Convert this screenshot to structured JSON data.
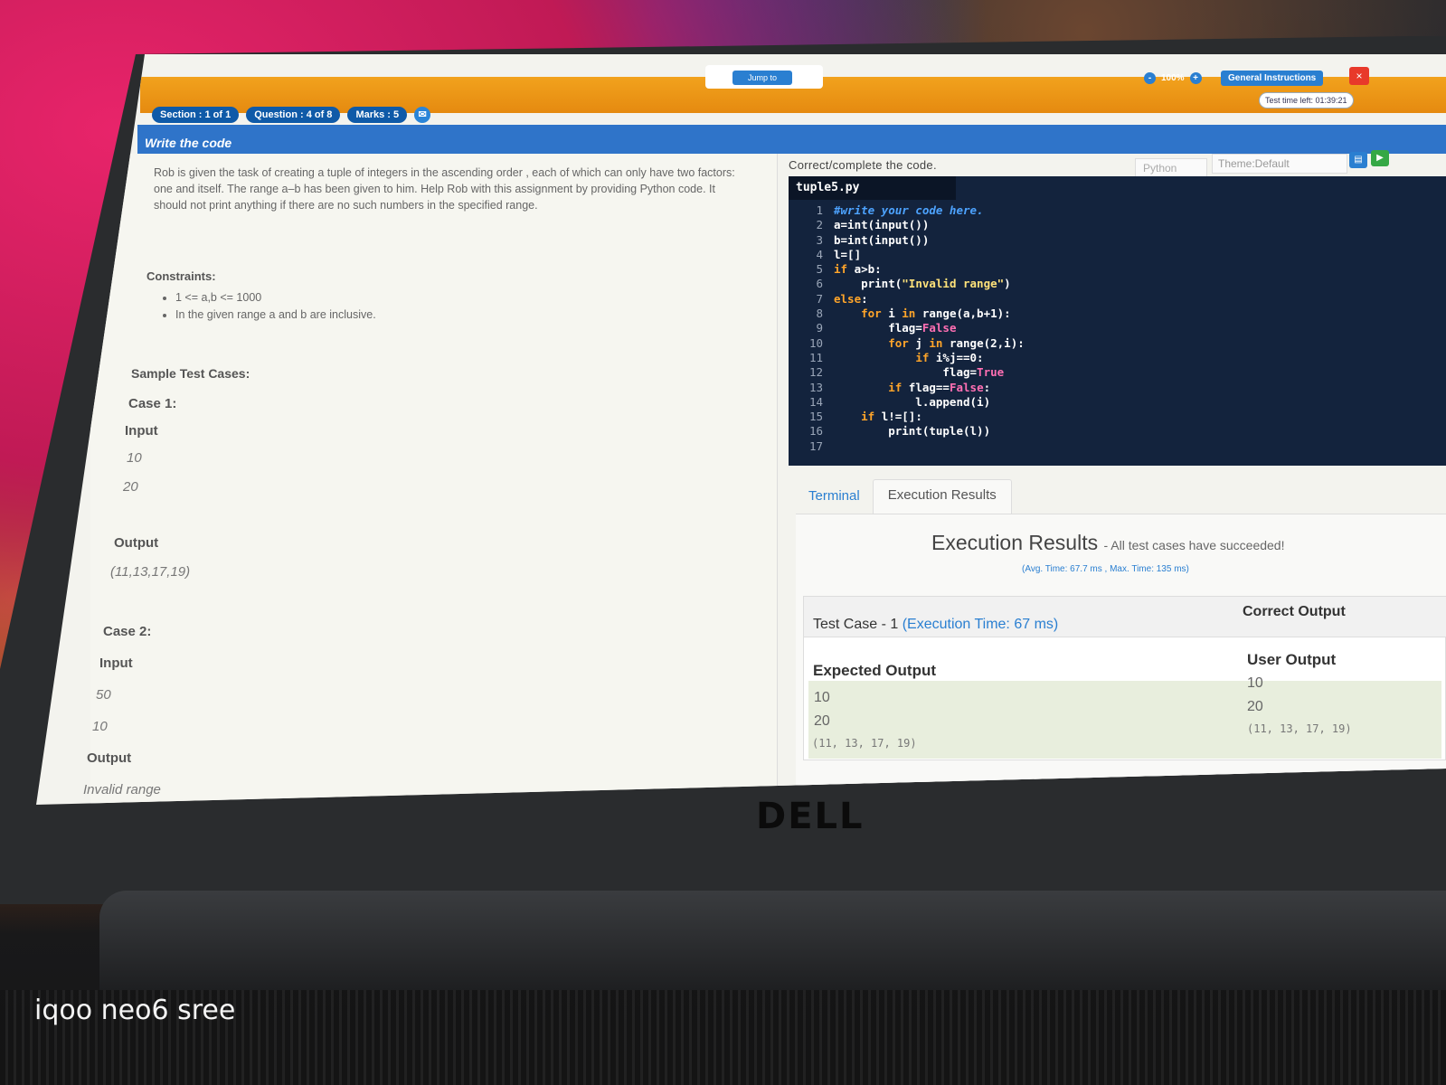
{
  "watermark": "iqoo neo6 sree",
  "brand": "DELL",
  "header": {
    "jump_label": "Jump to",
    "zoom": "100%",
    "zoom_minus": "-",
    "zoom_plus": "+",
    "instructions_label": "General Instructions",
    "close_label": "×",
    "timer": "Test time left: 01:39:21",
    "section": "Section : 1 of 1",
    "question": "Question : 4 of 8",
    "marks": "Marks : 5",
    "title": "Write the code"
  },
  "problem": {
    "text": "Rob is given the task of creating a tuple of integers in the ascending order , each of which can only have two factors: one and itself. The range a–b has been given to him. Help Rob with this assignment by providing Python code. It should not print anything if there are no such numbers in the specified range.",
    "constraints_heading": "Constraints:",
    "constraints": [
      "1 <= a,b <= 1000",
      "In the given range a and b are inclusive."
    ],
    "sample_heading": "Sample Test Cases:",
    "case1_label": "Case 1:",
    "case1_input_label": "Input",
    "case1_inputs": [
      "10",
      "20"
    ],
    "case1_output_label": "Output",
    "case1_output": "(11,13,17,19)",
    "case2_label": "Case 2:",
    "case2_input_label": "Input",
    "case2_inputs": [
      "50",
      "10"
    ],
    "case2_output_label": "Output",
    "case2_output": "Invalid range"
  },
  "editor": {
    "heading": "Correct/complete the code.",
    "language": "Python",
    "theme": "Theme:Default",
    "filename": "tuple5.py"
  },
  "tabs": {
    "terminal": "Terminal",
    "execution": "Execution Results"
  },
  "results": {
    "title": "Execution Results",
    "subtitle": "- All test cases have succeeded!",
    "timing": "(Avg. Time: 67.7 ms , Max. Time: 135 ms)",
    "case_name": "Test Case - 1",
    "case_time": "(Execution Time: 67 ms)",
    "correct_output": "Correct Output",
    "expected_label": "Expected Output",
    "user_label": "User Output",
    "expected_lines": [
      "10",
      "20"
    ],
    "expected_tuple": "(11, 13, 17, 19)",
    "user_lines": [
      "10",
      "20"
    ],
    "user_tuple": "(11, 13, 17, 19)"
  }
}
